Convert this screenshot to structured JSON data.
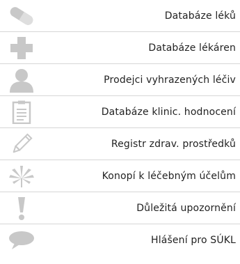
{
  "menu": {
    "icon_color": "#c8c8c8",
    "items": [
      {
        "label": "Databáze léků",
        "icon": "pill-icon"
      },
      {
        "label": "Databáze lékáren",
        "icon": "cross-icon"
      },
      {
        "label": "Prodejci vyhrazených léčiv",
        "icon": "person-icon"
      },
      {
        "label": "Databáze klinic. hodnocení",
        "icon": "clipboard-icon"
      },
      {
        "label": "Registr zdrav. prostředků",
        "icon": "pencil-icon"
      },
      {
        "label": "Konopí k léčebným účelům",
        "icon": "cannabis-leaf-icon"
      },
      {
        "label": "Důležitá upozornění",
        "icon": "exclamation-icon"
      },
      {
        "label": "Hlášení pro SÚKL",
        "icon": "speech-bubble-icon"
      }
    ]
  }
}
